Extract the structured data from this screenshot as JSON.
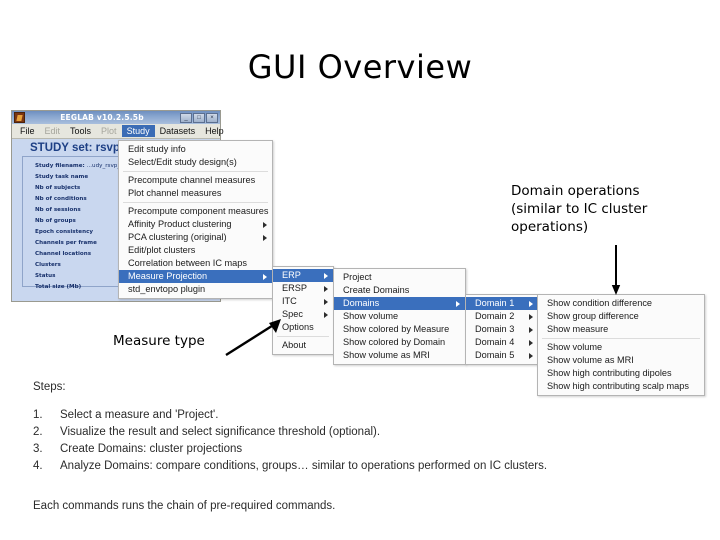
{
  "slide": {
    "title": "GUI Overview"
  },
  "eeglab_window": {
    "title": "EEGLAB v10.2.5.5b",
    "window_buttons": [
      "minimize",
      "maximize",
      "close"
    ],
    "menubar": [
      {
        "label": "File",
        "state": "normal"
      },
      {
        "label": "Edit",
        "state": "disabled"
      },
      {
        "label": "Tools",
        "state": "normal"
      },
      {
        "label": "Plot",
        "state": "disabled"
      },
      {
        "label": "Study",
        "state": "active"
      },
      {
        "label": "Datasets",
        "state": "normal"
      },
      {
        "label": "Help",
        "state": "normal"
      }
    ],
    "study_heading": "STUDY set: rsvp",
    "study_fields": [
      {
        "label": "Study filename:",
        "value": "...udy_rsvp_wi"
      },
      {
        "label": "Study task name",
        "value": ""
      },
      {
        "label": "Nb of subjects",
        "value": ""
      },
      {
        "label": "Nb of conditions",
        "value": ""
      },
      {
        "label": "Nb of sessions",
        "value": ""
      },
      {
        "label": "Nb of groups",
        "value": ""
      },
      {
        "label": "Epoch consistency",
        "value": ""
      },
      {
        "label": "Channels per frame",
        "value": ""
      },
      {
        "label": "Channel locations",
        "value": ""
      },
      {
        "label": "Clusters",
        "value": ""
      },
      {
        "label": "Status",
        "value": ""
      },
      {
        "label": "Total size (Mb)",
        "value": ""
      }
    ]
  },
  "menus": {
    "study": {
      "name": "Study menu",
      "items": [
        {
          "label": "Edit study info",
          "submenu": false,
          "selected": false,
          "separator_after": false
        },
        {
          "label": "Select/Edit study design(s)",
          "submenu": false,
          "selected": false,
          "separator_after": true
        },
        {
          "label": "Precompute channel measures",
          "submenu": false,
          "selected": false,
          "separator_after": false
        },
        {
          "label": "Plot channel measures",
          "submenu": false,
          "selected": false,
          "separator_after": true
        },
        {
          "label": "Precompute component measures",
          "submenu": false,
          "selected": false,
          "separator_after": false
        },
        {
          "label": "Affinity Product clustering",
          "submenu": true,
          "selected": false,
          "separator_after": false
        },
        {
          "label": "PCA clustering (original)",
          "submenu": true,
          "selected": false,
          "separator_after": false
        },
        {
          "label": "Edit/plot clusters",
          "submenu": false,
          "selected": false,
          "separator_after": false
        },
        {
          "label": "Correlation between IC maps",
          "submenu": false,
          "selected": false,
          "separator_after": false
        },
        {
          "label": "Measure Projection",
          "submenu": true,
          "selected": true,
          "separator_after": false
        },
        {
          "label": "std_envtopo plugin",
          "submenu": false,
          "selected": false,
          "separator_after": false
        }
      ]
    },
    "measure": {
      "name": "Measure type submenu",
      "items": [
        {
          "label": "ERP",
          "submenu": true,
          "selected": true,
          "separator_after": false
        },
        {
          "label": "ERSP",
          "submenu": true,
          "selected": false,
          "separator_after": false
        },
        {
          "label": "ITC",
          "submenu": true,
          "selected": false,
          "separator_after": false
        },
        {
          "label": "Spec",
          "submenu": true,
          "selected": false,
          "separator_after": false
        },
        {
          "label": "Options",
          "submenu": false,
          "selected": false,
          "separator_after": true
        },
        {
          "label": "About",
          "submenu": false,
          "selected": false,
          "separator_after": false
        }
      ]
    },
    "projection": {
      "name": "Projection submenu",
      "items": [
        {
          "label": "Project",
          "submenu": false,
          "selected": false,
          "separator_after": false
        },
        {
          "label": "Create Domains",
          "submenu": false,
          "selected": false,
          "separator_after": false
        },
        {
          "label": "Domains",
          "submenu": true,
          "selected": true,
          "separator_after": false
        },
        {
          "label": "Show volume",
          "submenu": false,
          "selected": false,
          "separator_after": false
        },
        {
          "label": "Show colored by Measure",
          "submenu": false,
          "selected": false,
          "separator_after": false
        },
        {
          "label": "Show colored by Domain",
          "submenu": false,
          "selected": false,
          "separator_after": false
        },
        {
          "label": "Show volume as MRI",
          "submenu": false,
          "selected": false,
          "separator_after": false
        }
      ]
    },
    "domain_list": {
      "name": "Domain list submenu",
      "items": [
        {
          "label": "Domain 1",
          "submenu": true,
          "selected": true,
          "separator_after": false
        },
        {
          "label": "Domain 2",
          "submenu": true,
          "selected": false,
          "separator_after": false
        },
        {
          "label": "Domain 3",
          "submenu": true,
          "selected": false,
          "separator_after": false
        },
        {
          "label": "Domain 4",
          "submenu": true,
          "selected": false,
          "separator_after": false
        },
        {
          "label": "Domain 5",
          "submenu": true,
          "selected": false,
          "separator_after": false
        }
      ]
    },
    "domain_ops": {
      "name": "Domain operations submenu",
      "items": [
        {
          "label": "Show condition difference",
          "submenu": false,
          "selected": false,
          "separator_after": false
        },
        {
          "label": "Show group difference",
          "submenu": false,
          "selected": false,
          "separator_after": false
        },
        {
          "label": "Show measure",
          "submenu": false,
          "selected": false,
          "separator_after": true
        },
        {
          "label": "Show volume",
          "submenu": false,
          "selected": false,
          "separator_after": false
        },
        {
          "label": "Show volume as MRI",
          "submenu": false,
          "selected": false,
          "separator_after": false
        },
        {
          "label": "Show high contributing dipoles",
          "submenu": false,
          "selected": false,
          "separator_after": false
        },
        {
          "label": "Show high contributing scalp maps",
          "submenu": false,
          "selected": false,
          "separator_after": false
        }
      ]
    }
  },
  "annotations": {
    "domain_operations": "Domain operations (similar to IC cluster operations)",
    "domain_operations_lines": [
      "Domain operations",
      "(similar to IC cluster",
      "operations)"
    ],
    "measure_type": "Measure type"
  },
  "steps": {
    "label": "Steps:",
    "items": [
      {
        "num": "1.",
        "text": "Select a measure and 'Project'."
      },
      {
        "num": "2.",
        "text": "Visualize the result and select significance threshold (optional)."
      },
      {
        "num": "3.",
        "text": "Create Domains: cluster projections"
      },
      {
        "num": "4.",
        "text": "Analyze Domains: compare conditions, groups… similar to operations performed on IC clusters."
      }
    ],
    "closing_note": "Each commands runs the chain of pre-required commands."
  },
  "colors": {
    "menu_highlight": "#3a6fbd",
    "titlebar_blue": "#8aa7d0",
    "panel_blue": "#c9d7ef",
    "heading_blue": "#1d3f85",
    "menu_bg": "#fbfbfb"
  }
}
